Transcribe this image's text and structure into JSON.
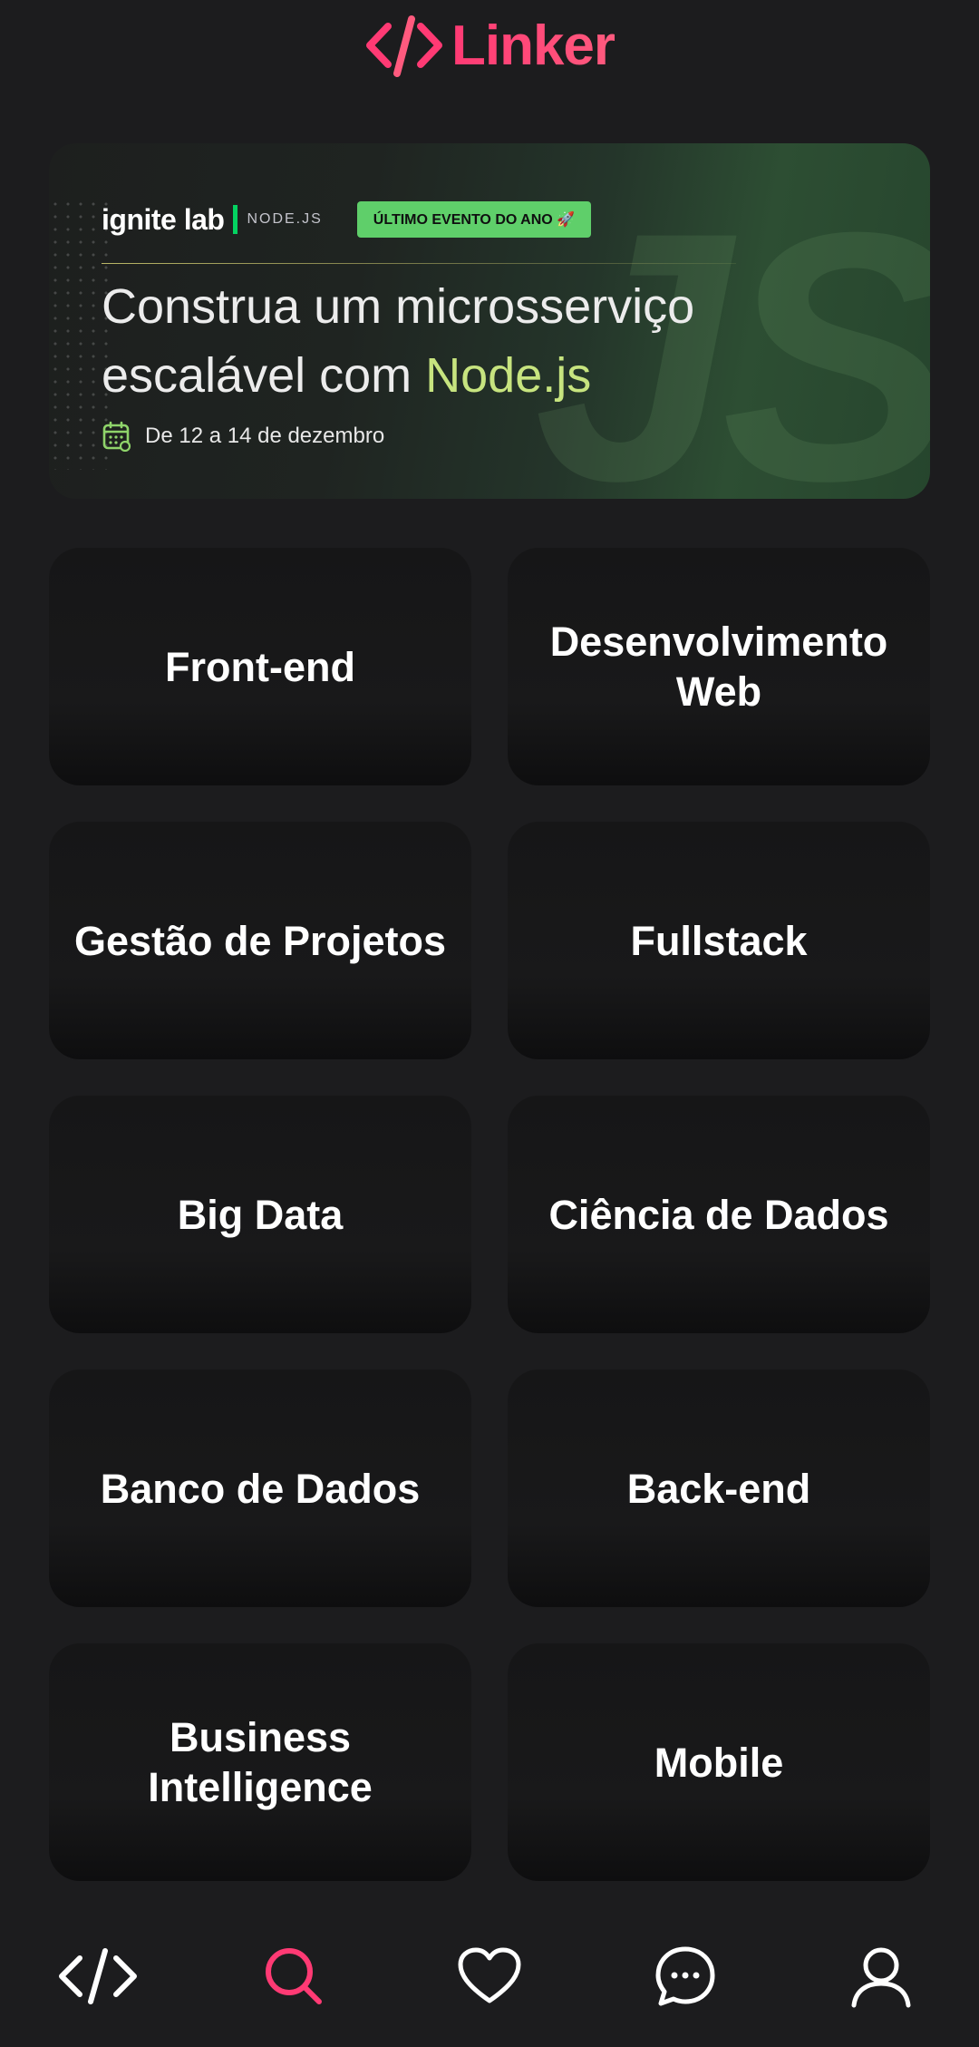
{
  "header": {
    "logo_text": "Linker"
  },
  "banner": {
    "brand": "ignite lab",
    "tag": "NODE.JS",
    "badge": "ÚLTIMO EVENTO DO ANO 🚀",
    "title_part1": "Construa um microsserviço escalável com ",
    "title_highlight": "Node.js",
    "date": "De 12 a 14 de dezembro",
    "watermark": "JS"
  },
  "categories": [
    {
      "label": "Front-end"
    },
    {
      "label": "Desenvolvimento Web"
    },
    {
      "label": "Gestão de Projetos"
    },
    {
      "label": "Fullstack"
    },
    {
      "label": "Big Data"
    },
    {
      "label": "Ciência de Dados"
    },
    {
      "label": "Banco de Dados"
    },
    {
      "label": "Back-end"
    },
    {
      "label": "Business Intelligence"
    },
    {
      "label": "Mobile"
    }
  ],
  "bottom_nav": [
    {
      "icon": "code-icon",
      "active": false
    },
    {
      "icon": "search-icon",
      "active": true
    },
    {
      "icon": "heart-icon",
      "active": false
    },
    {
      "icon": "chat-icon",
      "active": false
    },
    {
      "icon": "user-icon",
      "active": false
    }
  ],
  "colors": {
    "accent": "#ff3a74",
    "background": "#1c1c1e",
    "highlight": "#c7e47f"
  }
}
